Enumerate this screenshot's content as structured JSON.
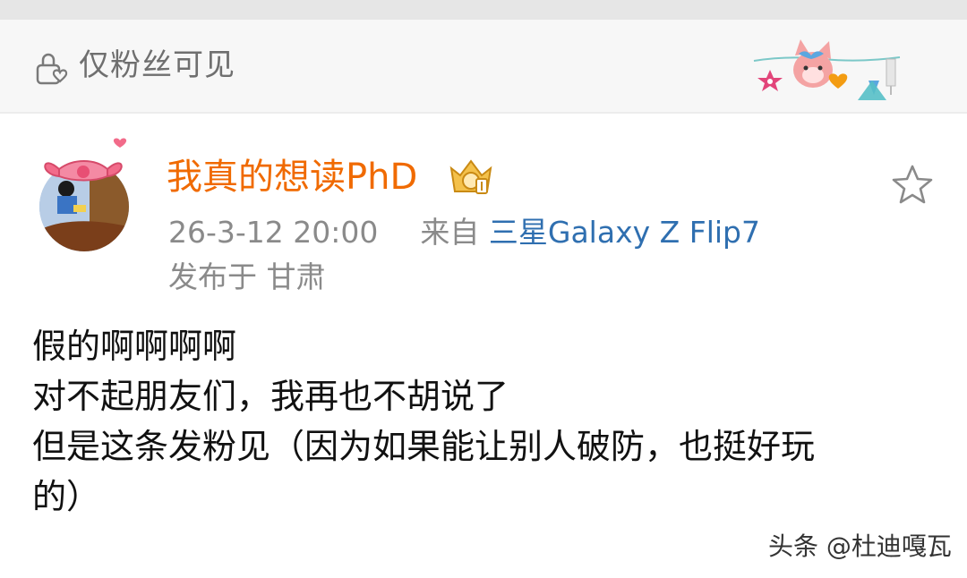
{
  "visibility": {
    "icon": "lock-heart-icon",
    "label": "仅粉丝可见"
  },
  "post": {
    "author": {
      "name": "我真的想读PhD",
      "avatar": "avatar-pink-bow",
      "badge_icon": "member-crown-badge-icon"
    },
    "meta": {
      "time": "26-3-12 20:00",
      "source_prefix": "来自",
      "source": "三星Galaxy Z Flip7",
      "location": "发布于 甘肃"
    },
    "actions": {
      "favorite_icon": "star-icon"
    },
    "content": {
      "lines": [
        "假的啊啊啊啊",
        "对不起朋友们，我再也不胡说了",
        "但是这条发粉见（因为如果能让别人破防，也挺好玩",
        "的）"
      ]
    }
  },
  "watermark": {
    "text": "头条 @杜迪嘎瓦"
  },
  "colors": {
    "author_name": "#f06a00",
    "source_link": "#2f6fb0",
    "meta_text": "#8a8a8a",
    "visibility_bg": "#f7f7f7"
  }
}
